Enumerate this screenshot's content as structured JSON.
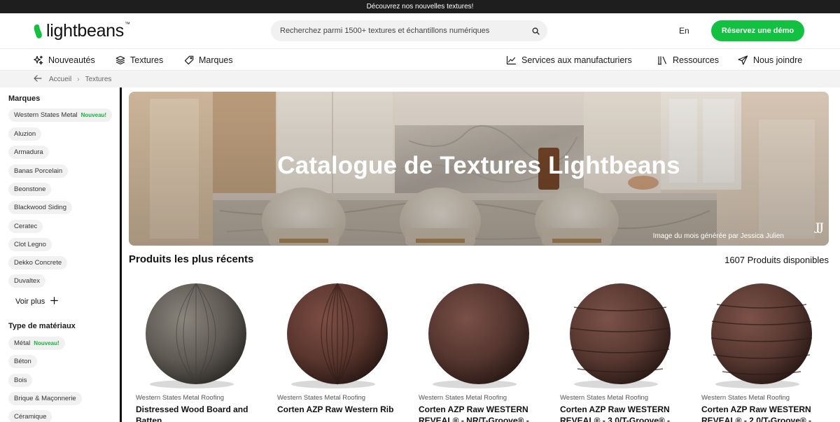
{
  "announcement": "Découvrez nos nouvelles textures!",
  "header": {
    "logo_text": "lightbeans",
    "logo_tm": "™",
    "search_placeholder": "Recherchez parmi 1500+ textures et échantillons numériques",
    "language": "En",
    "demo_button": "Réservez une démo"
  },
  "nav": {
    "left": [
      {
        "label": "Nouveautés",
        "icon": "sparkles-icon"
      },
      {
        "label": "Textures",
        "icon": "layers-icon"
      },
      {
        "label": "Marques",
        "icon": "tag-icon"
      }
    ],
    "right": [
      {
        "label": "Services aux manufacturiers",
        "icon": "chart-line-icon"
      },
      {
        "label": "Ressources",
        "icon": "library-icon"
      },
      {
        "label": "Nous joindre",
        "icon": "send-icon"
      }
    ]
  },
  "breadcrumb": {
    "back_icon": "arrow-left-icon",
    "items": [
      "Accueil",
      "Textures"
    ],
    "separator": "›"
  },
  "sidebar": {
    "brands_heading": "Marques",
    "brands": [
      {
        "label": "Western States Metal",
        "badge": "Nouveau!"
      },
      {
        "label": "Aluzion",
        "badge": ""
      },
      {
        "label": "Armadura",
        "badge": ""
      },
      {
        "label": "Banas Porcelain",
        "badge": ""
      },
      {
        "label": "Beonstone",
        "badge": ""
      },
      {
        "label": "Blackwood Siding",
        "badge": ""
      },
      {
        "label": "Ceratec",
        "badge": ""
      },
      {
        "label": "Clot Legno",
        "badge": ""
      },
      {
        "label": "Dekko Concrete",
        "badge": ""
      },
      {
        "label": "Duvaltex",
        "badge": ""
      }
    ],
    "see_more": "Voir plus",
    "see_more_icon": "plus-icon",
    "materials_heading": "Type de matériaux",
    "materials": [
      {
        "label": "Métal",
        "badge": "Nouveau!"
      },
      {
        "label": "Béton",
        "badge": ""
      },
      {
        "label": "Bois",
        "badge": ""
      },
      {
        "label": "Brique & Maçonnerie",
        "badge": ""
      },
      {
        "label": "Céramique",
        "badge": ""
      }
    ]
  },
  "hero": {
    "title": "Catalogue de Textures Lightbeans",
    "credit": "Image du mois générée par Jessica Julien",
    "monogram": "JJ"
  },
  "products": {
    "heading": "Produits les plus récents",
    "count": "1607 Produits disponibles",
    "items": [
      {
        "brand": "Western States Metal Roofing",
        "name": "Distressed Wood Board and Batten",
        "color": "#6f6a63"
      },
      {
        "brand": "Western States Metal Roofing",
        "name": "Corten AZP Raw Western Rib",
        "color": "#5e3a32"
      },
      {
        "brand": "Western States Metal Roofing",
        "name": "Corten AZP Raw WESTERN REVEAL® - NR/T-Groove® -",
        "color": "#5a3a34"
      },
      {
        "brand": "Western States Metal Roofing",
        "name": "Corten AZP Raw WESTERN REVEAL® - 3.0/T-Groove® -",
        "color": "#5b3b35"
      },
      {
        "brand": "Western States Metal Roofing",
        "name": "Corten AZP Raw WESTERN REVEAL® - 2.0/T-Groove® -",
        "color": "#5b3b35"
      }
    ]
  },
  "colors": {
    "accent": "#12c140",
    "announcement_bg": "#1e1e1e",
    "chip_bg": "#f1f1f1",
    "badge_text": "#17b33d"
  }
}
